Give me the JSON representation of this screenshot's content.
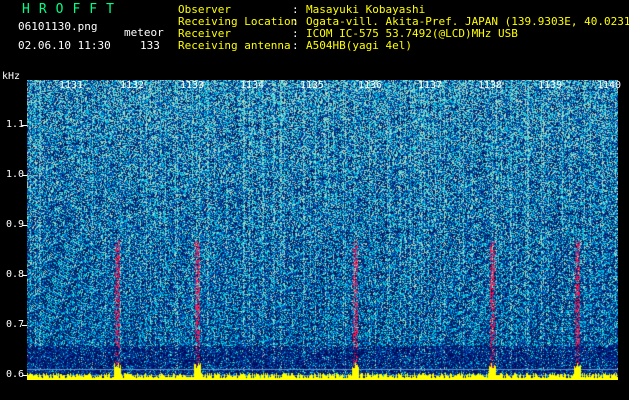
{
  "header": {
    "logo": "HROFFT",
    "filename": "06101130.png",
    "datetime": "02.06.10 11:30",
    "meteor_label": "meteor",
    "meteor_count": "133"
  },
  "info": {
    "observer_label": "Observer",
    "observer_value": "Masayuki Kobayashi",
    "location_label": "Receiving Location",
    "location_value": "Ogata-vill. Akita-Pref. JAPAN (139.9303E, 40.0231N)",
    "receiver_label": "Receiver",
    "receiver_value": "ICOM IC-575 53.7492(@LCD)MHz USB",
    "antenna_label": "Receiving antenna",
    "antenna_value": "A504HB(yagi 4el)"
  },
  "plot": {
    "y_unit": "kHz",
    "y_ticks": [
      "1.1",
      "1.0",
      "0.9",
      "0.8",
      "0.7",
      "0.6"
    ],
    "x_ticks": [
      "1131",
      "1132",
      "1133",
      "1134",
      "1135",
      "1136",
      "1137",
      "1138",
      "1139",
      "1140"
    ],
    "colors": {
      "background": "#000000",
      "noise_low": "#00205a",
      "noise_mid": "#0050c8",
      "noise_high": "#00c8ff",
      "hot": "#ff0040",
      "signal": "#ffff00"
    }
  }
}
